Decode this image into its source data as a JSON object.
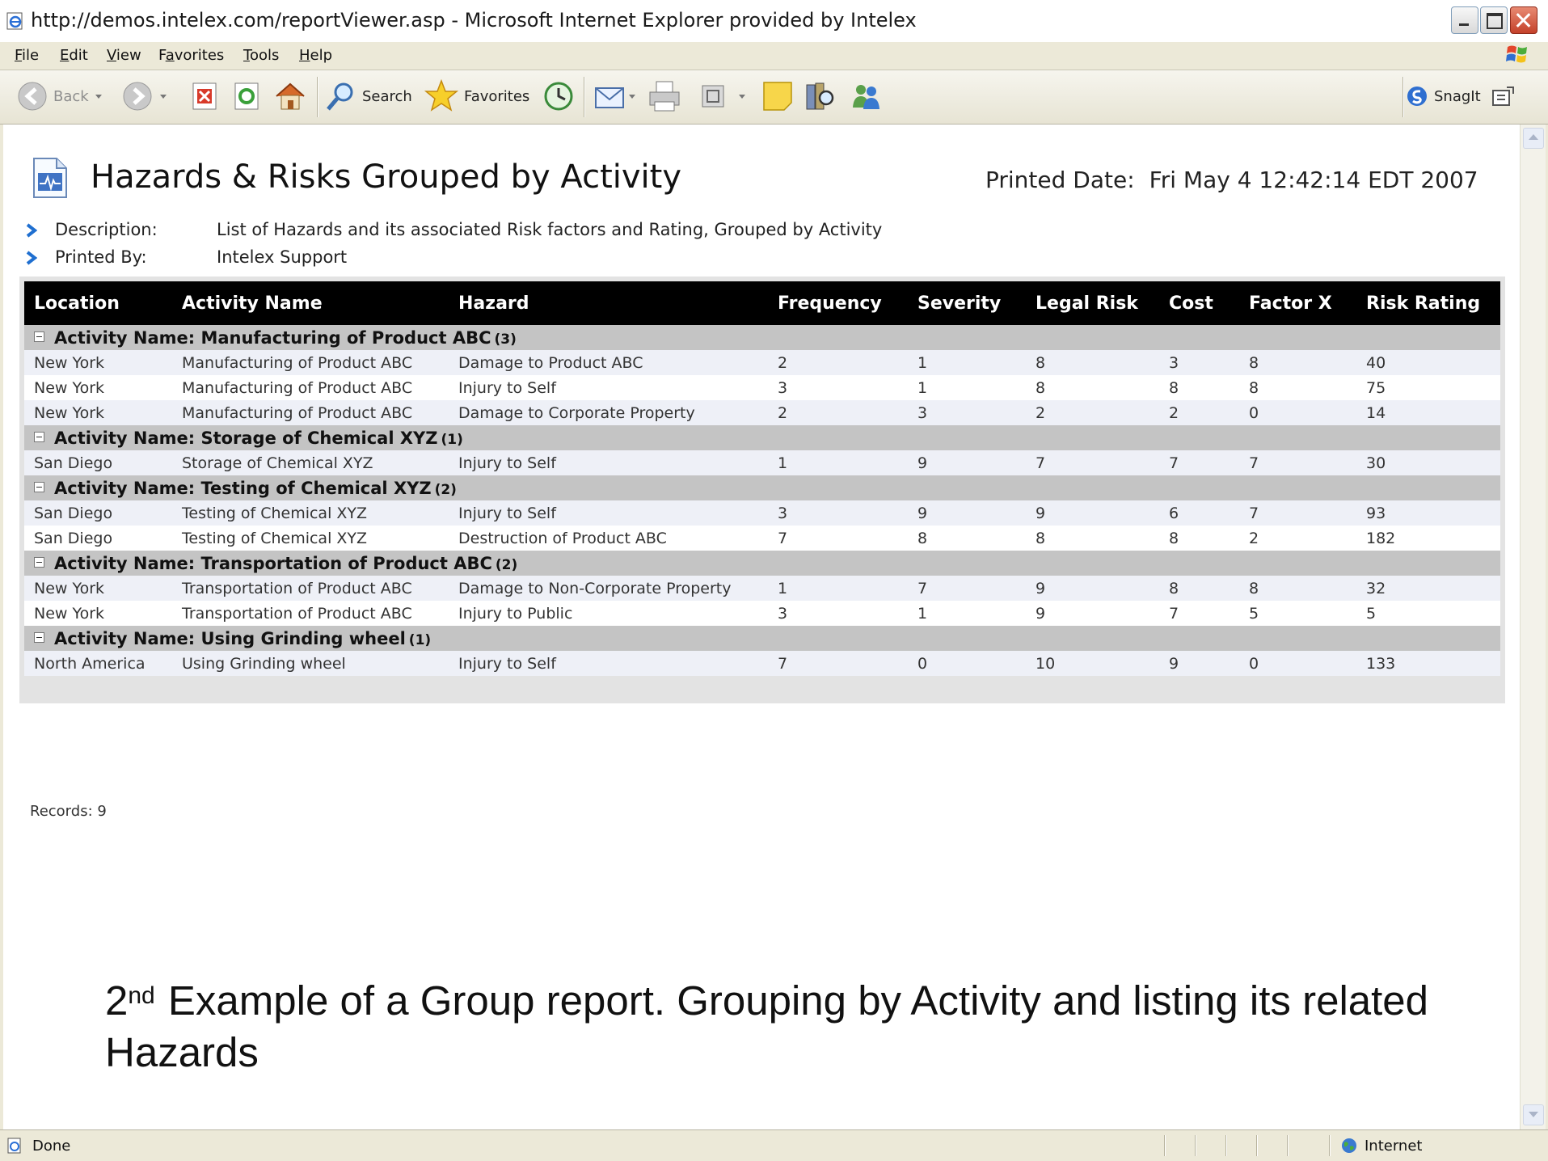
{
  "window": {
    "title": "http://demos.intelex.com/reportViewer.asp - Microsoft Internet Explorer provided by Intelex"
  },
  "menu": [
    {
      "pre": "",
      "acc": "F",
      "post": "ile"
    },
    {
      "pre": "",
      "acc": "E",
      "post": "dit"
    },
    {
      "pre": "",
      "acc": "V",
      "post": "iew"
    },
    {
      "pre": "F",
      "acc": "a",
      "post": "vorites"
    },
    {
      "pre": "",
      "acc": "T",
      "post": "ools"
    },
    {
      "pre": "",
      "acc": "H",
      "post": "elp"
    }
  ],
  "toolbar": {
    "back": "Back",
    "search": "Search",
    "favorites": "Favorites",
    "snagit": "SnagIt"
  },
  "report": {
    "title": "Hazards & Risks Grouped by Activity",
    "printed_label": "Printed Date:",
    "printed_value": "Fri May 4 12:42:14 EDT 2007",
    "description_label": "Description:",
    "description_value": "List of Hazards and its associated Risk factors and Rating, Grouped by Activity",
    "printed_by_label": "Printed By:",
    "printed_by_value": "Intelex Support",
    "columns": [
      "Location",
      "Activity Name",
      "Hazard",
      "Frequency",
      "Severity",
      "Legal Risk",
      "Cost",
      "Factor X",
      "Risk Rating"
    ],
    "groups": [
      {
        "label": "Activity Name: Manufacturing of Product ABC",
        "count": "(3)",
        "rows": [
          [
            "New York",
            "Manufacturing of Product ABC",
            "Damage to Product ABC",
            "2",
            "1",
            "8",
            "3",
            "8",
            "40"
          ],
          [
            "New York",
            "Manufacturing of Product ABC",
            "Injury to Self",
            "3",
            "1",
            "8",
            "8",
            "8",
            "75"
          ],
          [
            "New York",
            "Manufacturing of Product ABC",
            "Damage to Corporate Property",
            "2",
            "3",
            "2",
            "2",
            "0",
            "14"
          ]
        ]
      },
      {
        "label": "Activity Name: Storage of Chemical XYZ",
        "count": "(1)",
        "rows": [
          [
            "San Diego",
            "Storage of Chemical XYZ",
            "Injury to Self",
            "1",
            "9",
            "7",
            "7",
            "7",
            "30"
          ]
        ]
      },
      {
        "label": "Activity Name: Testing of Chemical XYZ",
        "count": "(2)",
        "rows": [
          [
            "San Diego",
            "Testing of Chemical XYZ",
            "Injury to Self",
            "3",
            "9",
            "9",
            "6",
            "7",
            "93"
          ],
          [
            "San Diego",
            "Testing of Chemical XYZ",
            "Destruction of Product ABC",
            "7",
            "8",
            "8",
            "8",
            "2",
            "182"
          ]
        ]
      },
      {
        "label": "Activity Name: Transportation of Product ABC",
        "count": "(2)",
        "rows": [
          [
            "New York",
            "Transportation of Product ABC",
            "Damage to Non-Corporate Property",
            "1",
            "7",
            "9",
            "8",
            "8",
            "32"
          ],
          [
            "New York",
            "Transportation of Product ABC",
            "Injury to Public",
            "3",
            "1",
            "9",
            "7",
            "5",
            "5"
          ]
        ]
      },
      {
        "label": "Activity Name: Using Grinding wheel",
        "count": "(1)",
        "rows": [
          [
            "North America",
            "Using Grinding wheel",
            "Injury to Self",
            "7",
            "0",
            "10",
            "9",
            "0",
            "133"
          ]
        ]
      }
    ],
    "records": "Records: 9"
  },
  "caption": {
    "num": "2",
    "sup": "nd",
    "text": " Example of a Group report. Grouping by Activity and listing its related Hazards"
  },
  "status": {
    "text": "Done",
    "zone": "Internet"
  }
}
